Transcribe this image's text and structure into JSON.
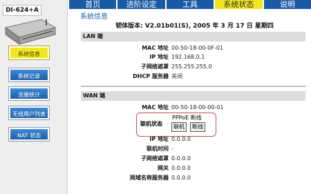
{
  "device": {
    "name": "DI-624+A"
  },
  "nav": {
    "tabs": [
      "首页",
      "进阶设定",
      "工具",
      "系统状态",
      "说明"
    ],
    "active_index": 3
  },
  "sidebar": {
    "items": [
      {
        "label": "系统信息",
        "active": true
      },
      {
        "label": "系统记录",
        "active": false
      },
      {
        "label": "流量统计",
        "active": false
      },
      {
        "label": "无线用户列表",
        "active": false
      },
      {
        "label": "NAT 状态",
        "active": false
      }
    ]
  },
  "main": {
    "title": "系统信息",
    "firmware": "韧体版本: V2.01b01(S), 2005 年  3 月  17 日  星期四"
  },
  "lan": {
    "header": "LAN 端",
    "rows": [
      {
        "label": "MAC 地址",
        "value": "00-50-18-00-0F-01"
      },
      {
        "label": "IP 地址",
        "value": "192.168.0.1"
      },
      {
        "label": "子网络遮罩",
        "value": "255.255.255.0"
      },
      {
        "label": "DHCP 服务器",
        "value": "关闭"
      }
    ]
  },
  "wan": {
    "header": "WAN 端",
    "mac_label": "MAC 地址",
    "mac_value": "00-50-18-00-00-01",
    "status_label": "联机状态",
    "status_value": "PPPoE 断线",
    "connect_button": "联机",
    "disconnect_button": "断线",
    "rows": [
      {
        "label": "IP 地址",
        "value": "0.0.0.0"
      },
      {
        "label": "联机时间",
        "value": "-"
      },
      {
        "label": "子网络遮罩",
        "value": "0.0.0.0"
      },
      {
        "label": "网关",
        "value": "0.0.0.0"
      },
      {
        "label": "网域名称服务器",
        "value": "0.0.0.0"
      }
    ]
  }
}
